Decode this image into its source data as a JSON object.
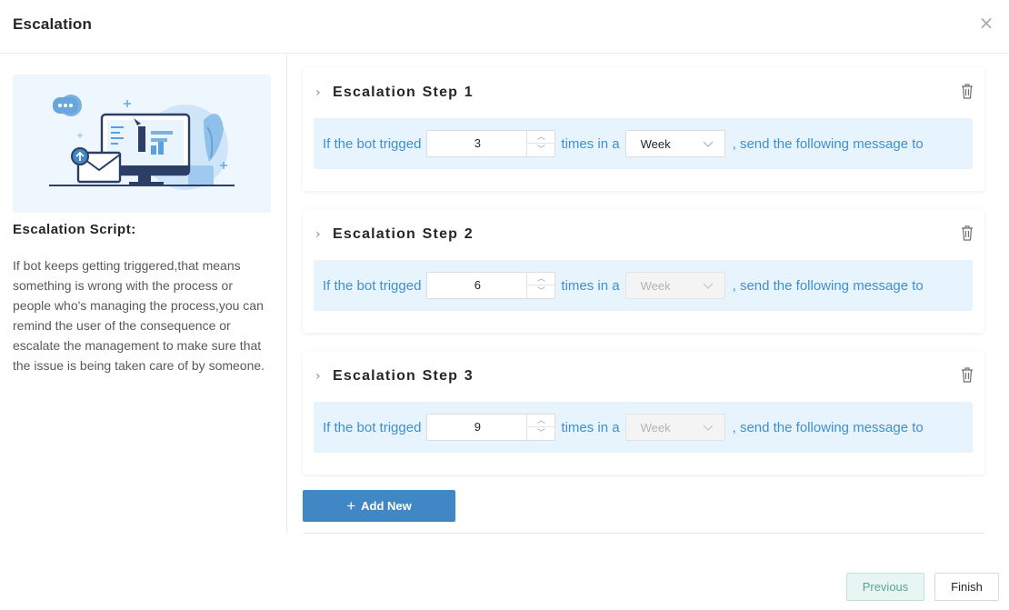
{
  "dialog": {
    "title": "Escalation",
    "close_symbol": "×"
  },
  "left": {
    "illustration": "computer-escalation-illustration",
    "script_title": "Escalation Script:",
    "script_text": "If bot keeps getting triggered,that means something is wrong with the process or people who's managing the process,you can remind the user of the consequence or escalate the management to make sure that the issue is being taken care of by someone."
  },
  "steps": [
    {
      "title": "Escalation Step  1",
      "prefix": "If the bot trigged",
      "count": "3",
      "mid": "times in a",
      "period": "Week",
      "period_disabled": false,
      "suffix": ", send the following message to"
    },
    {
      "title": "Escalation Step  2",
      "prefix": "If the bot trigged",
      "count": "6",
      "mid": "times in a",
      "period": "Week",
      "period_disabled": true,
      "suffix": ", send the following message to"
    },
    {
      "title": "Escalation Step  3",
      "prefix": "If the bot trigged",
      "count": "9",
      "mid": "times in a",
      "period": "Week",
      "period_disabled": true,
      "suffix": ", send the following message to"
    }
  ],
  "add_button": {
    "icon": "+",
    "label": "Add New"
  },
  "footer": {
    "previous_label": "Previous",
    "finish_label": "Finish"
  },
  "icons": {
    "chevron": "›",
    "up": "︿",
    "down": "﹀"
  },
  "colors": {
    "accent_text": "#3f8fd0",
    "rule_bg": "#e8f4fd",
    "primary_button": "#3f88c5",
    "previous_bg": "#e8f6f3"
  }
}
